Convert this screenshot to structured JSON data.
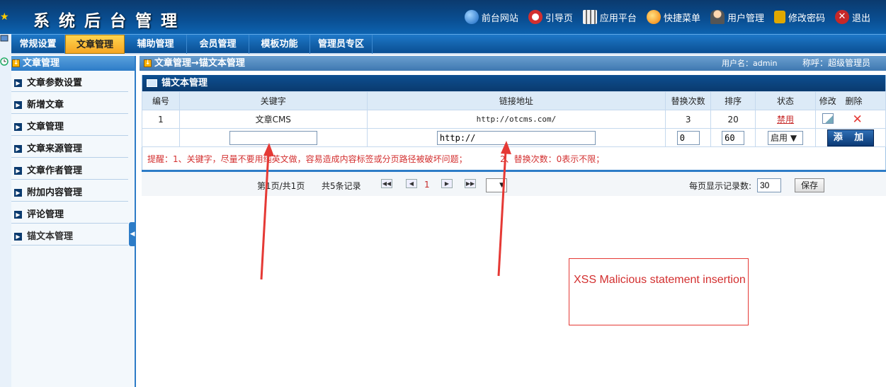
{
  "header": {
    "title": "系统后台管理",
    "links": [
      {
        "label": "前台网站",
        "icon": "globe-icon"
      },
      {
        "label": "引导页",
        "icon": "lifebuoy-icon"
      },
      {
        "label": "应用平台",
        "icon": "apps-icon"
      },
      {
        "label": "快捷菜单",
        "icon": "shortcut-icon"
      },
      {
        "label": "用户管理",
        "icon": "user-icon"
      },
      {
        "label": "修改密码",
        "icon": "lock-icon"
      },
      {
        "label": "退出",
        "icon": "exit-icon"
      }
    ]
  },
  "nav": {
    "tabs": [
      {
        "label": "常规设置"
      },
      {
        "label": "文章管理",
        "active": true
      },
      {
        "label": "辅助管理"
      },
      {
        "label": "会员管理"
      },
      {
        "label": "模板功能"
      },
      {
        "label": "管理员专区"
      }
    ]
  },
  "sidebar": {
    "heading": "文章管理",
    "items": [
      {
        "label": "文章参数设置"
      },
      {
        "label": "新增文章"
      },
      {
        "label": "文章管理"
      },
      {
        "label": "文章来源管理"
      },
      {
        "label": "文章作者管理"
      },
      {
        "label": "附加内容管理"
      },
      {
        "label": "评论管理"
      },
      {
        "label": "锚文本管理"
      }
    ]
  },
  "breadcrumb": {
    "path": "文章管理→锚文本管理",
    "user": "用户名：admin",
    "role": "称呼：超级管理员"
  },
  "panel": {
    "title": "锚文本管理",
    "columns": [
      "编号",
      "关键字",
      "链接地址",
      "替换次数",
      "排序",
      "状态",
      "修改",
      "删除"
    ],
    "rows": [
      {
        "id": "1",
        "keyword": "文章CMS",
        "url": "http://otcms.com/",
        "times": "3",
        "order": "20",
        "status": "禁用"
      }
    ],
    "new_row": {
      "keyword": "",
      "url": "http://",
      "times": "0",
      "order": "60",
      "status": "启用",
      "add_label": "添 加"
    },
    "tip1": "提醒：1、关键字，尽量不要用纯英文做，容易造成内容标签或分页路径被破坏问题；",
    "tip2": "2、替换次数：0表示不限；"
  },
  "pager": {
    "page_info": "第1页/共1页",
    "record_count": "共5条记录",
    "current_page": "1",
    "per_page_label": "每页显示记录数:",
    "per_page": "30",
    "save_label": "保存"
  },
  "annotation": {
    "text": "XSS Malicious statement insertion"
  }
}
